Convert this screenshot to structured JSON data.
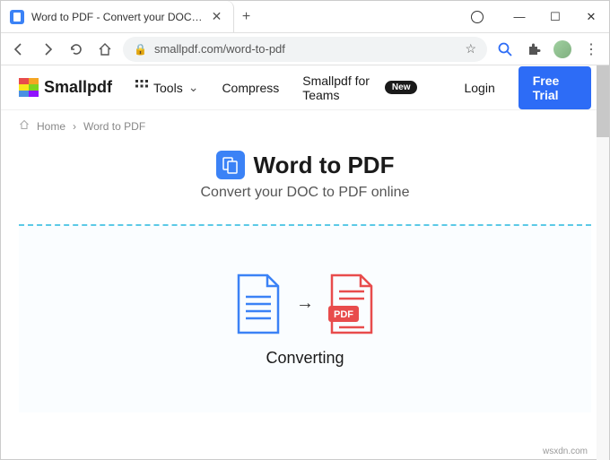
{
  "window": {
    "tab_title": "Word to PDF - Convert your DOC…",
    "minimize": "—",
    "maximize": "☐",
    "close": "✕"
  },
  "browser": {
    "url": "smallpdf.com/word-to-pdf"
  },
  "header": {
    "brand": "Smallpdf",
    "nav": {
      "tools": "Tools",
      "compress": "Compress",
      "teams": "Smallpdf for Teams",
      "teams_badge": "New",
      "login": "Login",
      "trial": "Free Trial"
    }
  },
  "breadcrumb": {
    "home": "Home",
    "sep": "›",
    "current": "Word to PDF"
  },
  "hero": {
    "title": "Word to PDF",
    "subtitle": "Convert your DOC to PDF online"
  },
  "convert": {
    "status": "Converting",
    "arrow": "→",
    "pdf_label": "PDF"
  },
  "watermark": "wsxdn.com"
}
